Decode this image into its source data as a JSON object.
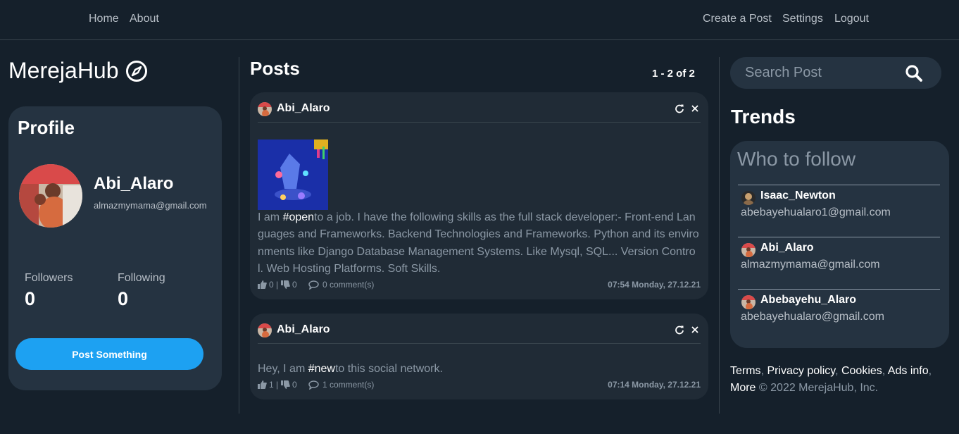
{
  "nav": {
    "left": [
      {
        "label": "Home"
      },
      {
        "label": "About"
      }
    ],
    "right": [
      {
        "label": "Create a Post"
      },
      {
        "label": "Settings"
      },
      {
        "label": "Logout"
      }
    ]
  },
  "brand": {
    "name": "MerejaHub",
    "icon": "compass-icon"
  },
  "profile": {
    "title": "Profile",
    "username": "Abi_Alaro",
    "email": "almazmymama@gmail.com",
    "followers_label": "Followers",
    "followers": "0",
    "following_label": "Following",
    "following": "0",
    "post_button": "Post Something"
  },
  "posts": {
    "title": "Posts",
    "pager": "1 - 2 of 2",
    "items": [
      {
        "user": "Abi_Alaro",
        "text_before": "I am ",
        "hashtag": "#open",
        "text_after": "to a job. I have the following skills as the full stack developer:- Front-end Languages and Frameworks. Backend Technologies and Frameworks. Python and its environments like Django Database Management Systems. Like Mysql, SQL... Version Control. Web Hosting Platforms. Soft Skills.",
        "likes": "0",
        "dislikes": "0",
        "comments": "0 comment(s)",
        "timestamp": "07:54 Monday, 27.12.21",
        "has_image": true
      },
      {
        "user": "Abi_Alaro",
        "text_before": "Hey, I am ",
        "hashtag": "#new",
        "text_after": "to this social network.",
        "likes": "1",
        "dislikes": "0",
        "comments": "1 comment(s)",
        "timestamp": "07:14 Monday, 27.12.21",
        "has_image": false
      }
    ]
  },
  "search": {
    "placeholder": "Search Post"
  },
  "trends": {
    "title": "Trends",
    "who_to_follow": "Who to follow",
    "users": [
      {
        "name": "Isaac_Newton",
        "email": "abebayehualaro1@gmail.com"
      },
      {
        "name": "Abi_Alaro",
        "email": "almazmymama@gmail.com"
      },
      {
        "name": "Abebayehu_Alaro",
        "email": "abebayehualaro@gmail.com"
      }
    ]
  },
  "footer": {
    "links": [
      "Terms",
      "Privacy policy",
      "Cookies",
      "Ads info",
      "More"
    ],
    "copyright": "© 2022 MerejaHub, Inc."
  },
  "colors": {
    "background": "#15202b",
    "card": "#253341",
    "accent": "#1da1f2",
    "muted": "#8b98a5"
  }
}
